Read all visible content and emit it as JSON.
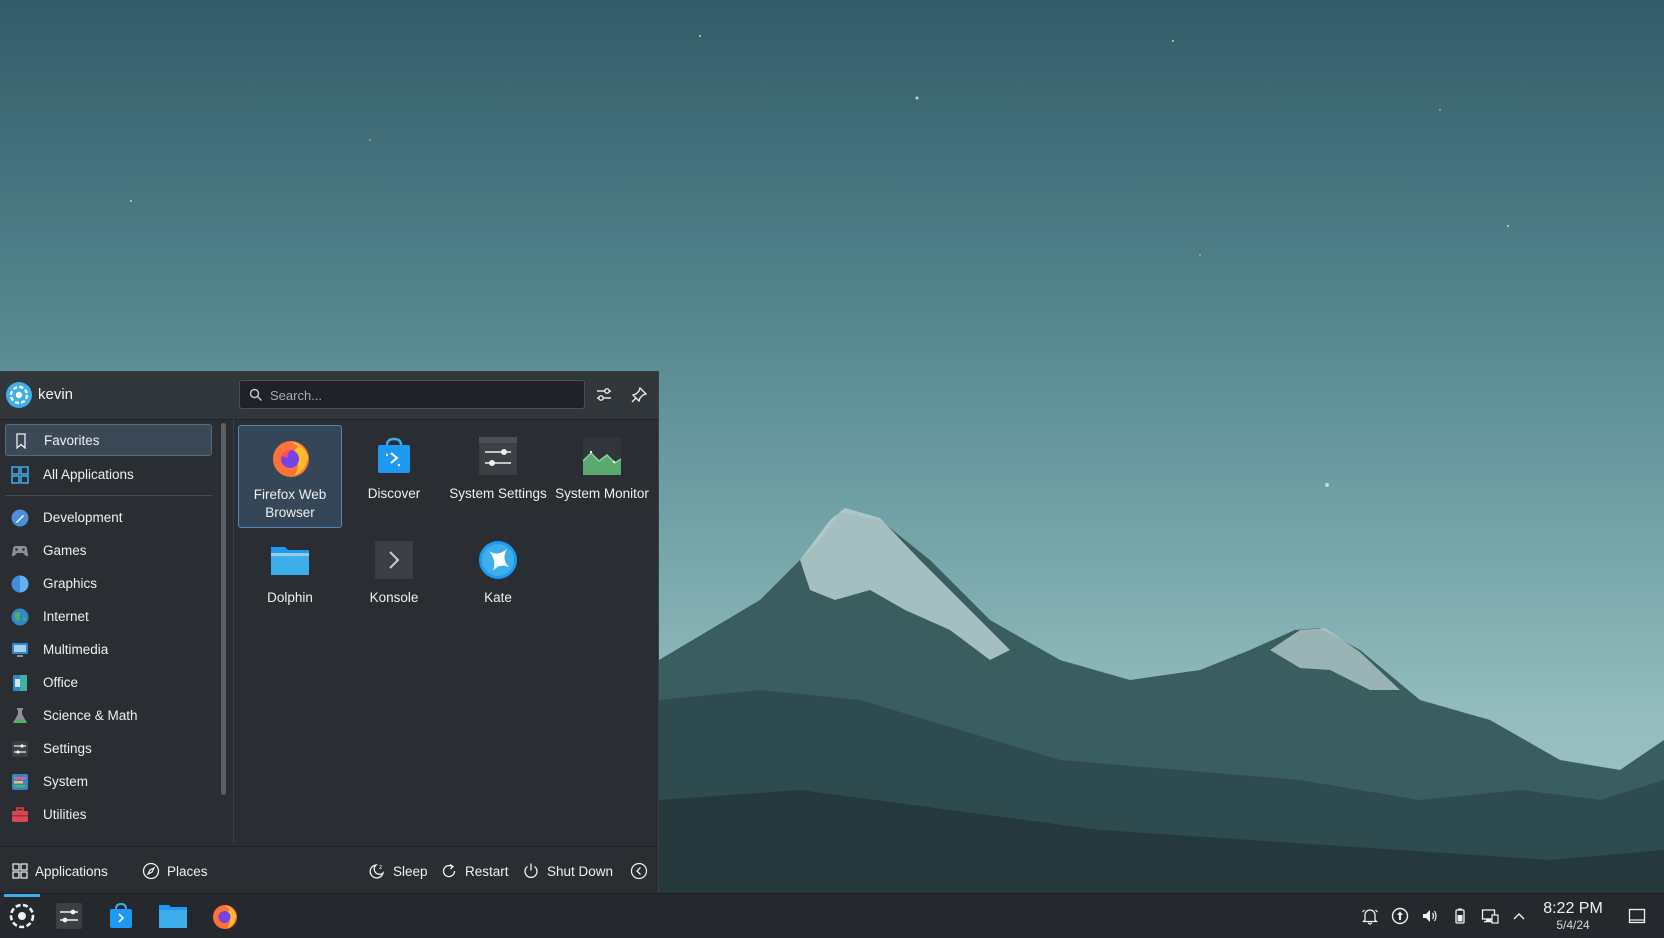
{
  "user": {
    "name": "kevin"
  },
  "search": {
    "placeholder": "Search..."
  },
  "sidebar": {
    "pinned": [
      {
        "label": "Favorites",
        "icon": "bookmark-icon",
        "active": true
      },
      {
        "label": "All Applications",
        "icon": "all-apps-grid-icon",
        "active": false
      }
    ],
    "categories": [
      {
        "label": "Development",
        "icon": "development-icon"
      },
      {
        "label": "Games",
        "icon": "gamepad-icon"
      },
      {
        "label": "Graphics",
        "icon": "graphics-icon"
      },
      {
        "label": "Internet",
        "icon": "globe-icon"
      },
      {
        "label": "Multimedia",
        "icon": "multimedia-icon"
      },
      {
        "label": "Office",
        "icon": "office-icon"
      },
      {
        "label": "Science & Math",
        "icon": "science-icon"
      },
      {
        "label": "Settings",
        "icon": "settings-sliders-icon"
      },
      {
        "label": "System",
        "icon": "system-icon"
      },
      {
        "label": "Utilities",
        "icon": "toolbox-icon"
      }
    ]
  },
  "favorites": [
    {
      "label": "Firefox Web Browser",
      "icon": "firefox-icon",
      "selected": true
    },
    {
      "label": "Discover",
      "icon": "discover-icon",
      "selected": false
    },
    {
      "label": "System Settings",
      "icon": "system-settings-icon",
      "selected": false
    },
    {
      "label": "System Monitor",
      "icon": "system-monitor-icon",
      "selected": false
    },
    {
      "label": "Dolphin",
      "icon": "folder-icon",
      "selected": false
    },
    {
      "label": "Konsole",
      "icon": "terminal-icon",
      "selected": false
    },
    {
      "label": "Kate",
      "icon": "kate-icon",
      "selected": false
    }
  ],
  "footer": {
    "applications_label": "Applications",
    "places_label": "Places",
    "sleep_label": "Sleep",
    "restart_label": "Restart",
    "shutdown_label": "Shut Down"
  },
  "taskbar": {
    "apps": [
      "kickoff-icon",
      "system-settings-icon",
      "discover-icon",
      "dolphin-icon",
      "firefox-icon"
    ],
    "tray": [
      "notifications-icon",
      "updates-icon",
      "volume-icon",
      "battery-icon",
      "network-icon",
      "tray-expand-icon"
    ]
  },
  "clock": {
    "time": "8:22 PM",
    "date": "5/4/24"
  },
  "colors": {
    "accent": "#3daee9",
    "panel_bg": "#2a2e32",
    "header_bg": "#31363b",
    "taskbar_bg": "#25292d"
  }
}
